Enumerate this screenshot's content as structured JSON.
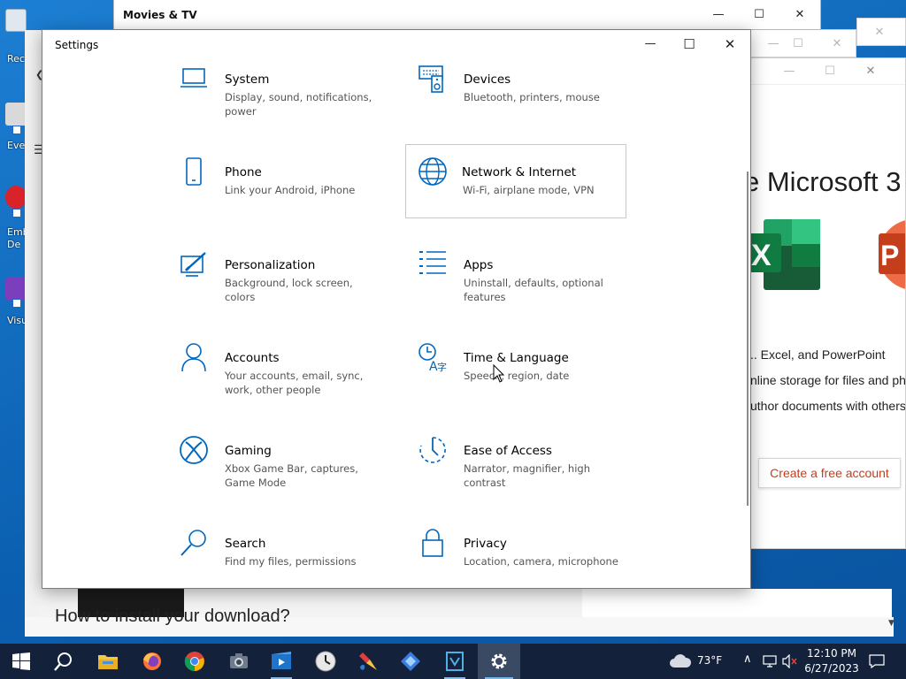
{
  "desktop": {
    "icons": [
      {
        "label": "Rec"
      },
      {
        "label": "Eve"
      },
      {
        "label": "Emb De"
      },
      {
        "label": "Visu"
      }
    ]
  },
  "windows": {
    "movies_tv": {
      "title": "Movies & TV",
      "heading": "How to install your download?"
    },
    "office": {
      "headline": "e Microsoft 3",
      "features": [
        ".. Excel, and PowerPoint",
        "nline storage for files and ph",
        "uthor documents with others"
      ],
      "cta_label": "Create a free account",
      "colors": {
        "cta_text": "#c43e1c",
        "excel_green": "#107c41",
        "ppt_orange": "#d35230"
      }
    },
    "settings": {
      "title": "Settings",
      "accent": "#0067c0",
      "tiles": [
        {
          "name": "System",
          "desc": "Display, sound, notifications, power",
          "icon": "laptop-icon"
        },
        {
          "name": "Devices",
          "desc": "Bluetooth, printers, mouse",
          "icon": "devices-icon"
        },
        {
          "name": "Phone",
          "desc": "Link your Android, iPhone",
          "icon": "phone-icon"
        },
        {
          "name": "Network & Internet",
          "desc": "Wi-Fi, airplane mode, VPN",
          "icon": "globe-icon"
        },
        {
          "name": "Personalization",
          "desc": "Background, lock screen, colors",
          "icon": "personalization-icon"
        },
        {
          "name": "Apps",
          "desc": "Uninstall, defaults, optional features",
          "icon": "apps-list-icon"
        },
        {
          "name": "Accounts",
          "desc": "Your accounts, email, sync, work, other people",
          "icon": "person-icon"
        },
        {
          "name": "Time & Language",
          "desc": "Speech, region, date",
          "icon": "time-language-icon"
        },
        {
          "name": "Gaming",
          "desc": "Xbox Game Bar, captures, Game Mode",
          "icon": "xbox-icon"
        },
        {
          "name": "Ease of Access",
          "desc": "Narrator, magnifier, high contrast",
          "icon": "ease-of-access-icon"
        },
        {
          "name": "Search",
          "desc": "Find my files, permissions",
          "icon": "search-icon"
        },
        {
          "name": "Privacy",
          "desc": "Location, camera, microphone",
          "icon": "lock-icon"
        }
      ]
    }
  },
  "caption_buttons": {
    "minimize": "—",
    "maximize": "☐",
    "close": "✕"
  },
  "taskbar": {
    "apps": [
      "start-icon",
      "search-icon",
      "file-explorer-icon",
      "firefox-icon",
      "chrome-icon",
      "camera-icon",
      "movies-tv-icon",
      "clock-app-icon",
      "paint-icon",
      "copilot-icon",
      "visual-studio-icon",
      "settings-gear-icon"
    ],
    "weather": "73°F",
    "time": "12:10 PM",
    "date": "6/27/2023"
  }
}
